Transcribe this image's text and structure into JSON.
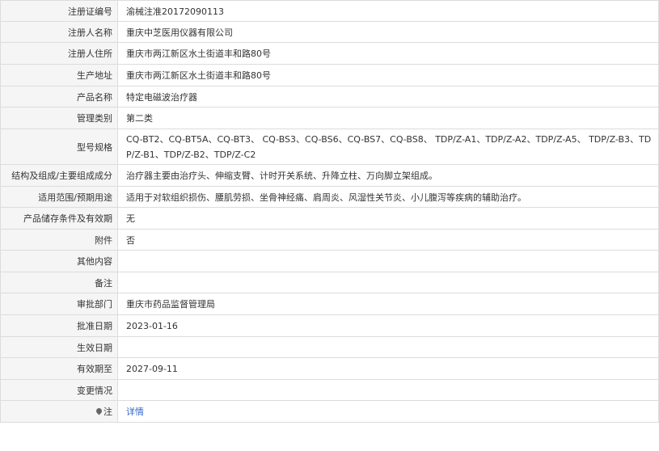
{
  "rows": [
    {
      "label": "注册证编号",
      "value": "渝械注准20172090113"
    },
    {
      "label": "注册人名称",
      "value": "重庆中芝医用仪器有限公司"
    },
    {
      "label": "注册人住所",
      "value": "重庆市两江新区水土街道丰和路80号"
    },
    {
      "label": "生产地址",
      "value": "重庆市两江新区水土街道丰和路80号"
    },
    {
      "label": "产品名称",
      "value": "特定电磁波治疗器"
    },
    {
      "label": "管理类别",
      "value": "第二类"
    },
    {
      "label": "型号规格",
      "value": "CQ-BT2、CQ-BT5A、CQ-BT3、 CQ-BS3、CQ-BS6、CQ-BS7、CQ-BS8、 TDP/Z-A1、TDP/Z-A2、TDP/Z-A5、 TDP/Z-B3、TDP/Z-B1、TDP/Z-B2、TDP/Z-C2"
    },
    {
      "label": "结构及组成/主要组成成分",
      "value": "治疗器主要由治疗头、伸缩支臂、计时开关系统、升降立柱、万向脚立架组成。"
    },
    {
      "label": "适用范围/预期用途",
      "value": "适用于对软组织损伤、腰肌劳损、坐骨神经痛、肩周炎、风湿性关节炎、小儿腹泻等疾病的辅助治疗。"
    },
    {
      "label": "产品储存条件及有效期",
      "value": "无"
    },
    {
      "label": "附件",
      "value": "否"
    },
    {
      "label": "其他内容",
      "value": ""
    },
    {
      "label": "备注",
      "value": ""
    },
    {
      "label": "审批部门",
      "value": "重庆市药品监督管理局"
    },
    {
      "label": "批准日期",
      "value": "2023-01-16"
    },
    {
      "label": "生效日期",
      "value": ""
    },
    {
      "label": "有效期至",
      "value": "2027-09-11"
    },
    {
      "label": "变更情况",
      "value": ""
    }
  ],
  "note": {
    "label": "注",
    "icon": "map-pin-icon",
    "link": "详情"
  }
}
